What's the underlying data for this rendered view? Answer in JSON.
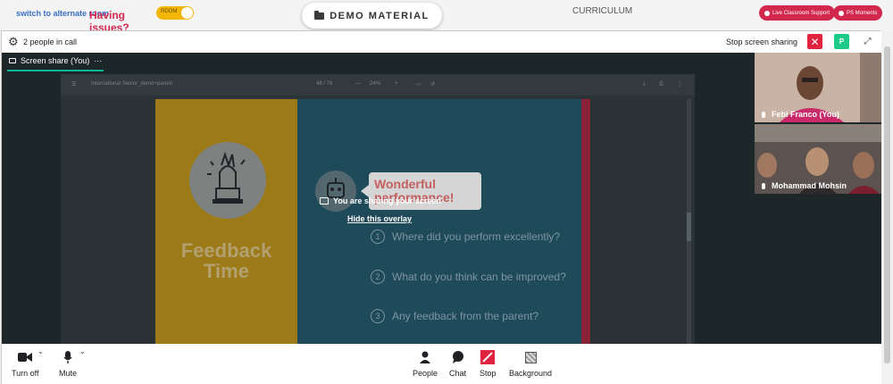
{
  "topbar": {
    "issues_label": "Having issues?",
    "alternate_label": "switch to alternate room",
    "toggle_label": "RDOM",
    "demo_button_label": "DEMO MATERIAL",
    "curriculum_label": "CURRICULUM",
    "live_support_label": "Live Classroom Support",
    "ps_moments_label": "PS Moments"
  },
  "call": {
    "people_count": "2 people in call",
    "stop_sharing_label": "Stop screen sharing",
    "participant_badge": "P",
    "tab_label": "Screen share (You)",
    "tab_more": "···",
    "overlay_message": "You are sharing your screen",
    "hide_overlay_label": "Hide this overlay"
  },
  "viewer": {
    "doc_title": "International Senior_demo+parent",
    "page_indicator": "48 / 76",
    "zoom": "24%"
  },
  "slide": {
    "left_title_line1": "Feedback",
    "left_title_line2": "Time",
    "bubble_line1": "Wonderful",
    "bubble_line2": "performance!",
    "questions": [
      {
        "num": "1",
        "text": "Where did you perform excellently?"
      },
      {
        "num": "2",
        "text": "What do you think can be improved?"
      },
      {
        "num": "3",
        "text": "Any feedback from the parent?"
      }
    ],
    "colors": {
      "left": "#9c7a18",
      "right": "#1e4a5a",
      "strip": "#8a2136"
    }
  },
  "participants": [
    {
      "name": "Febi Franco (You)"
    },
    {
      "name": "Mohammad Mohsin"
    }
  ],
  "controls": {
    "turn_off": "Turn off",
    "mute": "Mute",
    "people": "People",
    "chat": "Chat",
    "stop": "Stop",
    "background": "Background"
  },
  "colors": {
    "accent_red": "#e0233f",
    "accent_green": "#1aca86",
    "brand_pink": "#d3284e"
  }
}
